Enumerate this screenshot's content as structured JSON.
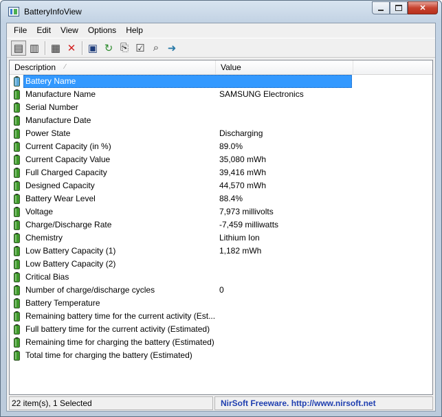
{
  "window": {
    "title": "BatteryInfoView"
  },
  "menu": [
    "File",
    "Edit",
    "View",
    "Options",
    "Help"
  ],
  "toolbar": [
    {
      "name": "html-report-all-icon",
      "pressed": true
    },
    {
      "name": "html-report-selected-icon",
      "pressed": false
    },
    {
      "sep": true
    },
    {
      "name": "properties-icon",
      "pressed": false
    },
    {
      "name": "delete-icon",
      "pressed": false
    },
    {
      "sep": true
    },
    {
      "name": "save-icon",
      "pressed": false
    },
    {
      "name": "refresh-icon",
      "pressed": false
    },
    {
      "name": "copy-icon",
      "pressed": false
    },
    {
      "name": "properties-window-icon",
      "pressed": false
    },
    {
      "name": "find-icon",
      "pressed": false
    },
    {
      "name": "exit-icon",
      "pressed": false
    }
  ],
  "columns": {
    "description": "Description",
    "value": "Value"
  },
  "rows": [
    {
      "desc": "Battery Name",
      "value": "",
      "selected": true
    },
    {
      "desc": "Manufacture Name",
      "value": "SAMSUNG Electronics"
    },
    {
      "desc": "Serial Number",
      "value": ""
    },
    {
      "desc": "Manufacture Date",
      "value": ""
    },
    {
      "desc": "Power State",
      "value": "Discharging"
    },
    {
      "desc": "Current Capacity (in %)",
      "value": "89.0%"
    },
    {
      "desc": "Current Capacity Value",
      "value": "35,080 mWh"
    },
    {
      "desc": "Full Charged Capacity",
      "value": "39,416 mWh"
    },
    {
      "desc": "Designed Capacity",
      "value": "44,570 mWh"
    },
    {
      "desc": "Battery Wear Level",
      "value": "88.4%"
    },
    {
      "desc": "Voltage",
      "value": "7,973 millivolts"
    },
    {
      "desc": "Charge/Discharge Rate",
      "value": "-7,459 milliwatts"
    },
    {
      "desc": "Chemistry",
      "value": "Lithium Ion"
    },
    {
      "desc": "Low Battery Capacity (1)",
      "value": "1,182 mWh"
    },
    {
      "desc": "Low Battery Capacity (2)",
      "value": ""
    },
    {
      "desc": "Critical Bias",
      "value": ""
    },
    {
      "desc": "Number of charge/discharge cycles",
      "value": "0"
    },
    {
      "desc": "Battery Temperature",
      "value": ""
    },
    {
      "desc": "Remaining battery time for the current activity (Est...",
      "value": ""
    },
    {
      "desc": "Full battery time for the current activity (Estimated)",
      "value": ""
    },
    {
      "desc": "Remaining time for charging the battery (Estimated)",
      "value": ""
    },
    {
      "desc": "Total  time for charging the battery (Estimated)",
      "value": ""
    }
  ],
  "status": {
    "left": "22 item(s), 1 Selected",
    "right": "NirSoft Freeware.  http://www.nirsoft.net"
  },
  "colors": {
    "selection": "#3399ff",
    "link": "#1f3fb0",
    "battery": "#3e9a2a"
  }
}
